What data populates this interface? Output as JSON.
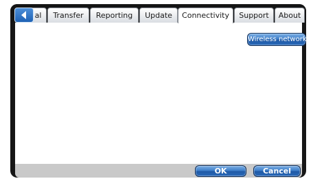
{
  "tabs": [
    {
      "label": "al",
      "active": false
    },
    {
      "label": "Transfer",
      "active": false
    },
    {
      "label": "Reporting",
      "active": false
    },
    {
      "label": "Update",
      "active": false
    },
    {
      "label": "Connectivity",
      "active": true
    },
    {
      "label": "Support",
      "active": false
    },
    {
      "label": "About",
      "active": false
    }
  ],
  "back_button": {
    "icon": "back-arrow-icon"
  },
  "content": {
    "wireless_button_label": "Wireless network"
  },
  "footer": {
    "ok_label": "OK",
    "cancel_label": "Cancel"
  },
  "colors": {
    "accent": "#2a6ab9",
    "frame": "#161616",
    "footer": "#c9c9c9"
  }
}
